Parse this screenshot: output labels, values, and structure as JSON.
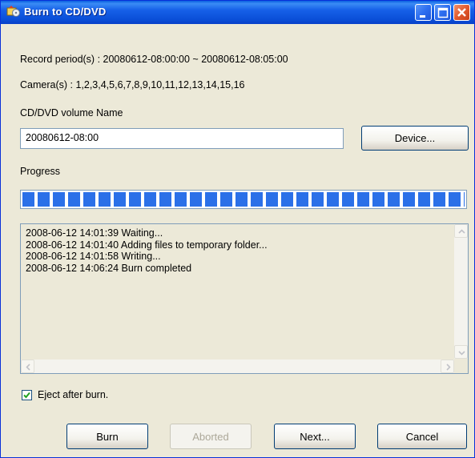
{
  "window": {
    "title": "Burn to CD/DVD",
    "icon": "burn-app-icon",
    "controls": {
      "minimize_icon": "minimize-icon",
      "maximize_icon": "maximize-icon",
      "close_icon": "close-icon"
    }
  },
  "info": {
    "record_period": "Record period(s) : 20080612-08:00:00 ~ 20080612-08:05:00",
    "cameras": "Camera(s) : 1,2,3,4,5,6,7,8,9,10,11,12,13,14,15,16"
  },
  "volume": {
    "label": "CD/DVD volume Name",
    "value": "20080612-08:00",
    "device_button": "Device..."
  },
  "progress": {
    "label": "Progress",
    "value": 1.0
  },
  "log": {
    "lines": [
      "2008-06-12 14:01:39 Waiting...",
      "2008-06-12 14:01:40 Adding files to temporary folder...",
      "2008-06-12 14:01:58 Writing...",
      "2008-06-12 14:06:24 Burn completed"
    ]
  },
  "eject": {
    "label": "Eject after burn.",
    "checked": true
  },
  "buttons": {
    "burn": "Burn",
    "aborted": "Aborted",
    "next": "Next...",
    "cancel": "Cancel"
  },
  "colors": {
    "titlebar": "#0a5fe0",
    "progress_fill": "#2b70e8",
    "dialog_bg": "#ece9d8"
  }
}
